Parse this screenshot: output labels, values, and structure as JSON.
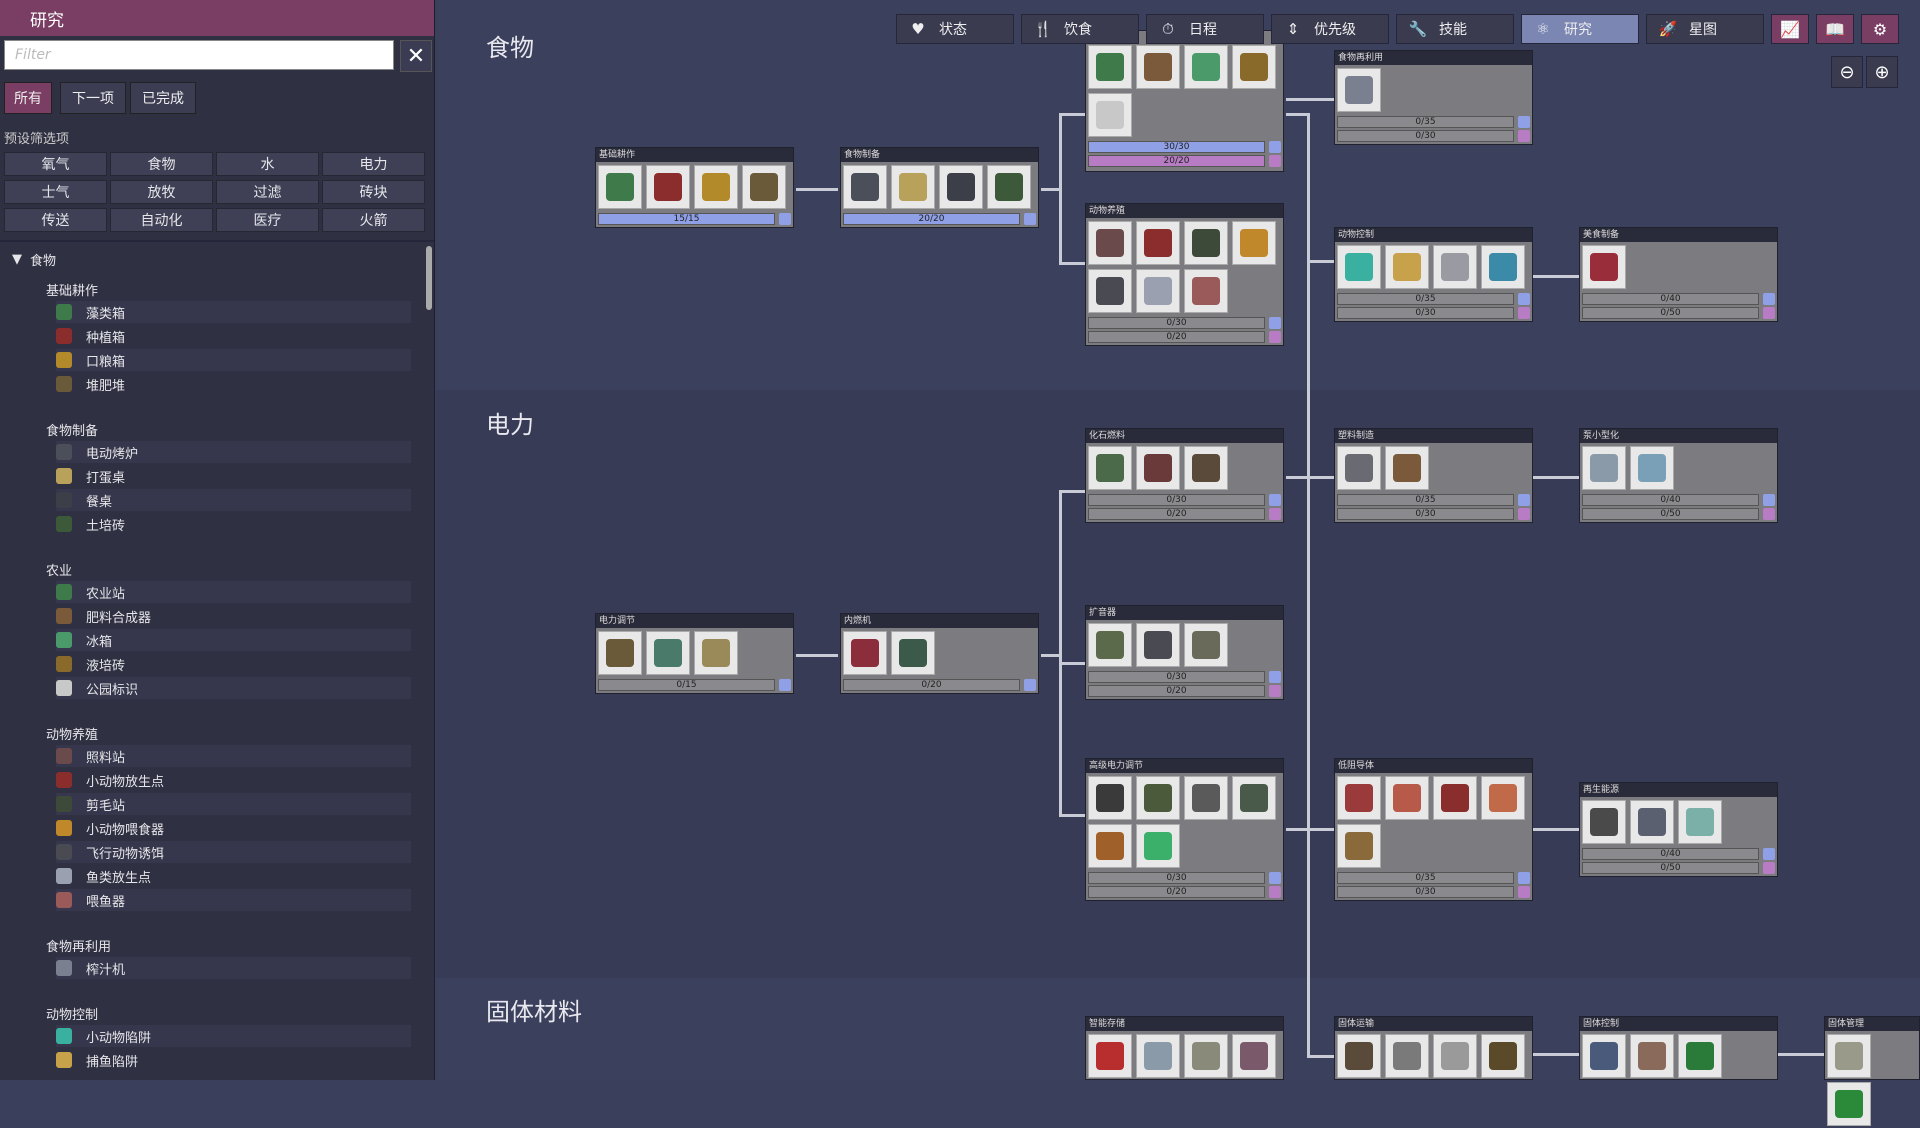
{
  "sidebar": {
    "title": "研究",
    "filter_placeholder": "Filter",
    "tabs": [
      "所有",
      "下一项",
      "已完成"
    ],
    "preset_label": "预设筛选项",
    "presets": [
      "氧气",
      "食物",
      "水",
      "电力",
      "士气",
      "放牧",
      "过滤",
      "砖块",
      "传送",
      "自动化",
      "医疗",
      "火箭"
    ],
    "tree": {
      "category": "食物",
      "groups": [
        {
          "name": "基础耕作",
          "items": [
            "藻类箱",
            "种植箱",
            "口粮箱",
            "堆肥堆"
          ]
        },
        {
          "name": "食物制备",
          "items": [
            "电动烤炉",
            "打蛋桌",
            "餐桌",
            "土培砖"
          ]
        },
        {
          "name": "农业",
          "items": [
            "农业站",
            "肥料合成器",
            "冰箱",
            "液培砖",
            "公园标识"
          ]
        },
        {
          "name": "动物养殖",
          "items": [
            "照料站",
            "小动物放生点",
            "剪毛站",
            "小动物喂食器",
            "飞行动物诱饵",
            "鱼类放生点",
            "喂鱼器"
          ]
        },
        {
          "name": "食物再利用",
          "items": [
            "榨汁机"
          ]
        },
        {
          "name": "动物控制",
          "items": [
            "小动物陷阱",
            "捕鱼陷阱"
          ]
        }
      ]
    }
  },
  "topbar": {
    "buttons": [
      {
        "label": "状态",
        "icon": "heart-icon"
      },
      {
        "label": "饮食",
        "icon": "fork-knife-icon"
      },
      {
        "label": "日程",
        "icon": "stopwatch-icon"
      },
      {
        "label": "优先级",
        "icon": "priority-icon"
      },
      {
        "label": "技能",
        "icon": "wrench-icon"
      },
      {
        "label": "研究",
        "icon": "research-icon",
        "active": true
      },
      {
        "label": "星图",
        "icon": "rocket-icon"
      }
    ],
    "icon_buttons": [
      "reports-icon",
      "codex-icon",
      "settings-icon"
    ]
  },
  "sections": [
    "食物",
    "电力",
    "固体材料"
  ],
  "nodes": {
    "basic_farming": {
      "title": "基础耕作",
      "bars": [
        "15/15"
      ]
    },
    "meal_prep": {
      "title": "食物制备",
      "bars": [
        "20/20"
      ]
    },
    "agriculture": {
      "title": "",
      "bars": [
        "30/30",
        "20/20"
      ]
    },
    "ranching": {
      "title": "动物养殖",
      "bars": [
        "0/30",
        "0/20"
      ]
    },
    "food_repurposing": {
      "title": "食物再利用",
      "bars": [
        "0/35",
        "0/30"
      ]
    },
    "animal_control": {
      "title": "动物控制",
      "bars": [
        "0/35",
        "0/30"
      ]
    },
    "gourmet": {
      "title": "美食制备",
      "bars": [
        "0/40",
        "0/50"
      ]
    },
    "power_regulation": {
      "title": "电力调节",
      "bars": [
        "0/15"
      ]
    },
    "combustion": {
      "title": "内燃机",
      "bars": [
        "0/20"
      ]
    },
    "fossil_fuels": {
      "title": "化石燃料",
      "bars": [
        "0/30",
        "0/20"
      ]
    },
    "plastics": {
      "title": "塑料制造",
      "bars": [
        "0/35",
        "0/30"
      ]
    },
    "miniaturization": {
      "title": "泵小型化",
      "bars": [
        "0/40",
        "0/50"
      ]
    },
    "sound_amplifiers": {
      "title": "扩音器",
      "bars": [
        "0/30",
        "0/20"
      ]
    },
    "adv_power": {
      "title": "高级电力调节",
      "bars": [
        "0/30",
        "0/20"
      ]
    },
    "low_resistance": {
      "title": "低阻导体",
      "bars": [
        "0/35",
        "0/30"
      ]
    },
    "renewable": {
      "title": "再生能源",
      "bars": [
        "0/40",
        "0/50"
      ]
    },
    "smart_storage": {
      "title": "智能存储",
      "bars": []
    },
    "solid_transport": {
      "title": "固体运输",
      "bars": []
    },
    "solid_control": {
      "title": "固体控制",
      "bars": []
    },
    "solid_management": {
      "title": "固体管理",
      "bars": []
    }
  },
  "colors": {
    "sidebar_header": "#7a3d63",
    "active_tab": "#7b86b3",
    "research_blue": "#8fa0e6",
    "research_pink": "#b77cc3"
  }
}
